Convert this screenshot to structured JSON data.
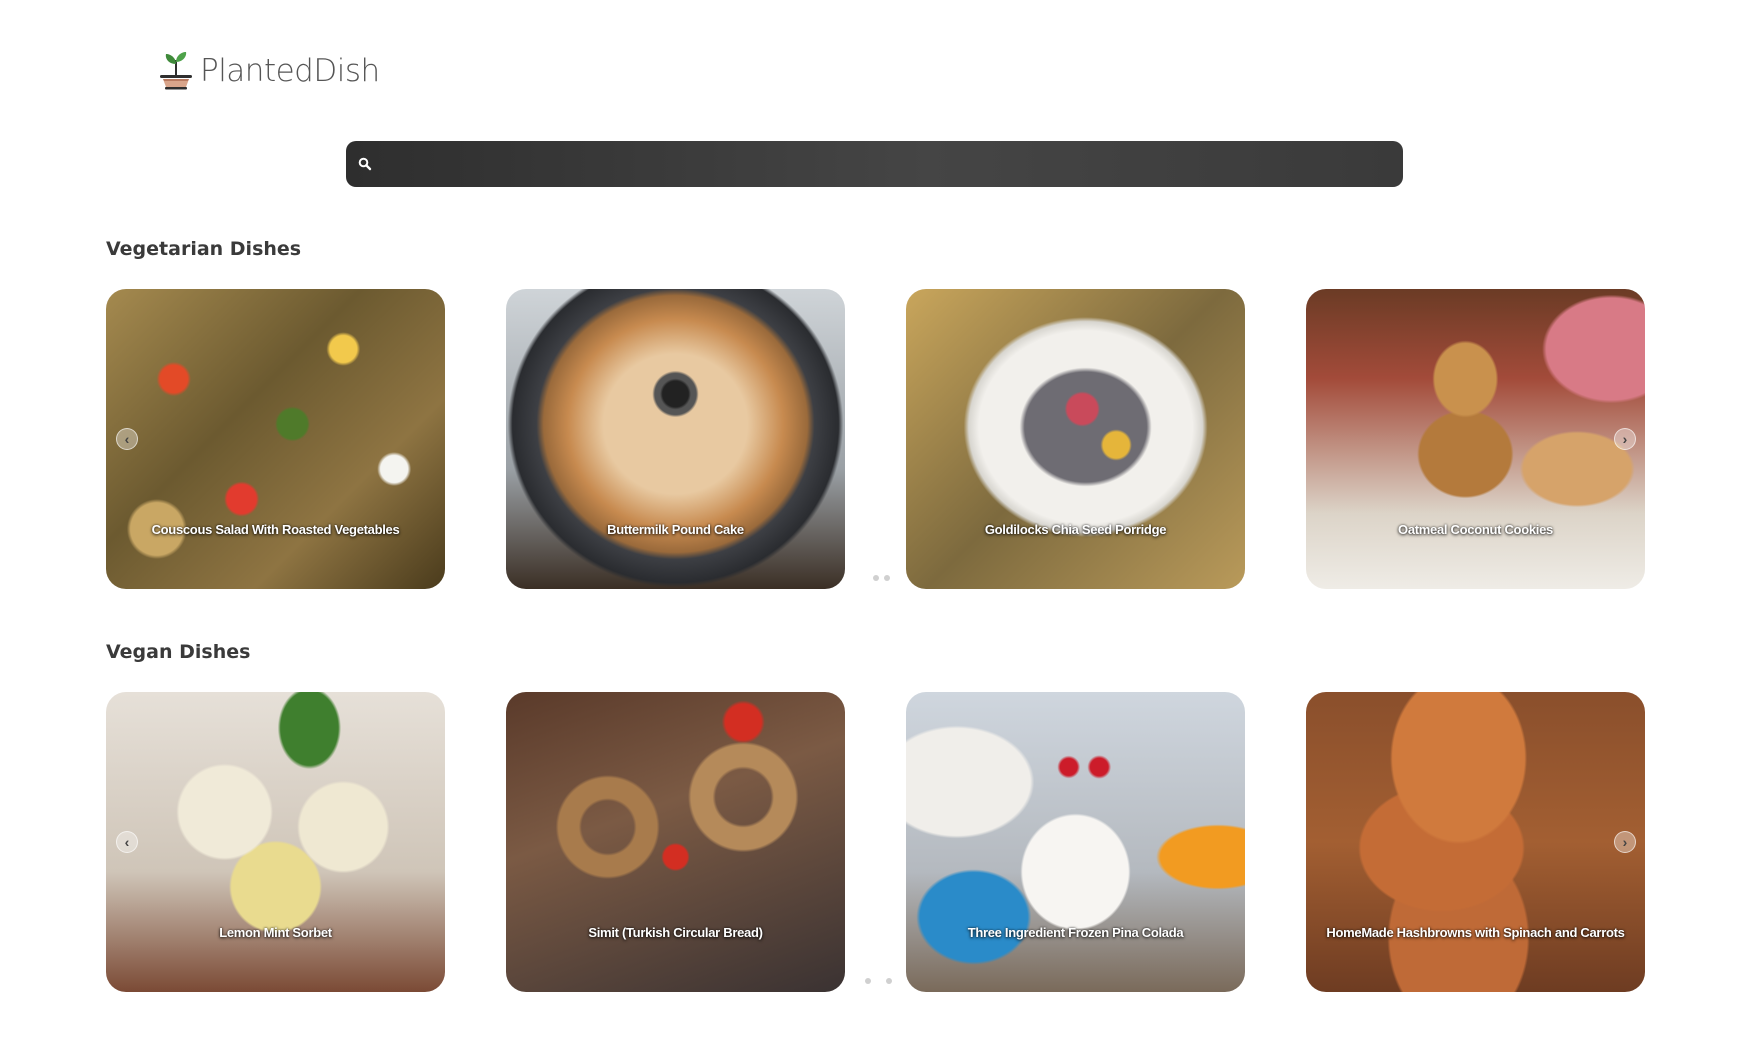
{
  "header": {
    "logo_text": "PlantedDish"
  },
  "search": {
    "placeholder": "",
    "value": ""
  },
  "sections": [
    {
      "title": "Vegetarian Dishes",
      "cards": [
        {
          "title": "Couscous Salad With Roasted Vegetables"
        },
        {
          "title": "Buttermilk Pound Cake"
        },
        {
          "title": "Goldilocks Chia Seed Porridge"
        },
        {
          "title": "Oatmeal Coconut Cookies"
        }
      ],
      "prev_icon": "chevron-left-icon",
      "next_icon": "chevron-right-icon"
    },
    {
      "title": "Vegan Dishes",
      "cards": [
        {
          "title": "Lemon Mint Sorbet"
        },
        {
          "title": "Simit (Turkish Circular Bread)"
        },
        {
          "title": "Three Ingredient Frozen Pina Colada"
        },
        {
          "title": "HomeMade Hashbrowns with Spinach and Carrots"
        }
      ],
      "prev_icon": "chevron-left-icon",
      "next_icon": "chevron-right-icon"
    }
  ],
  "colors": {
    "search_bg": "#3a3a3a",
    "heading": "#3a3a3a",
    "logo_text": "#555555",
    "pot": "#c98a6a",
    "leaf": "#3f8a3a"
  }
}
